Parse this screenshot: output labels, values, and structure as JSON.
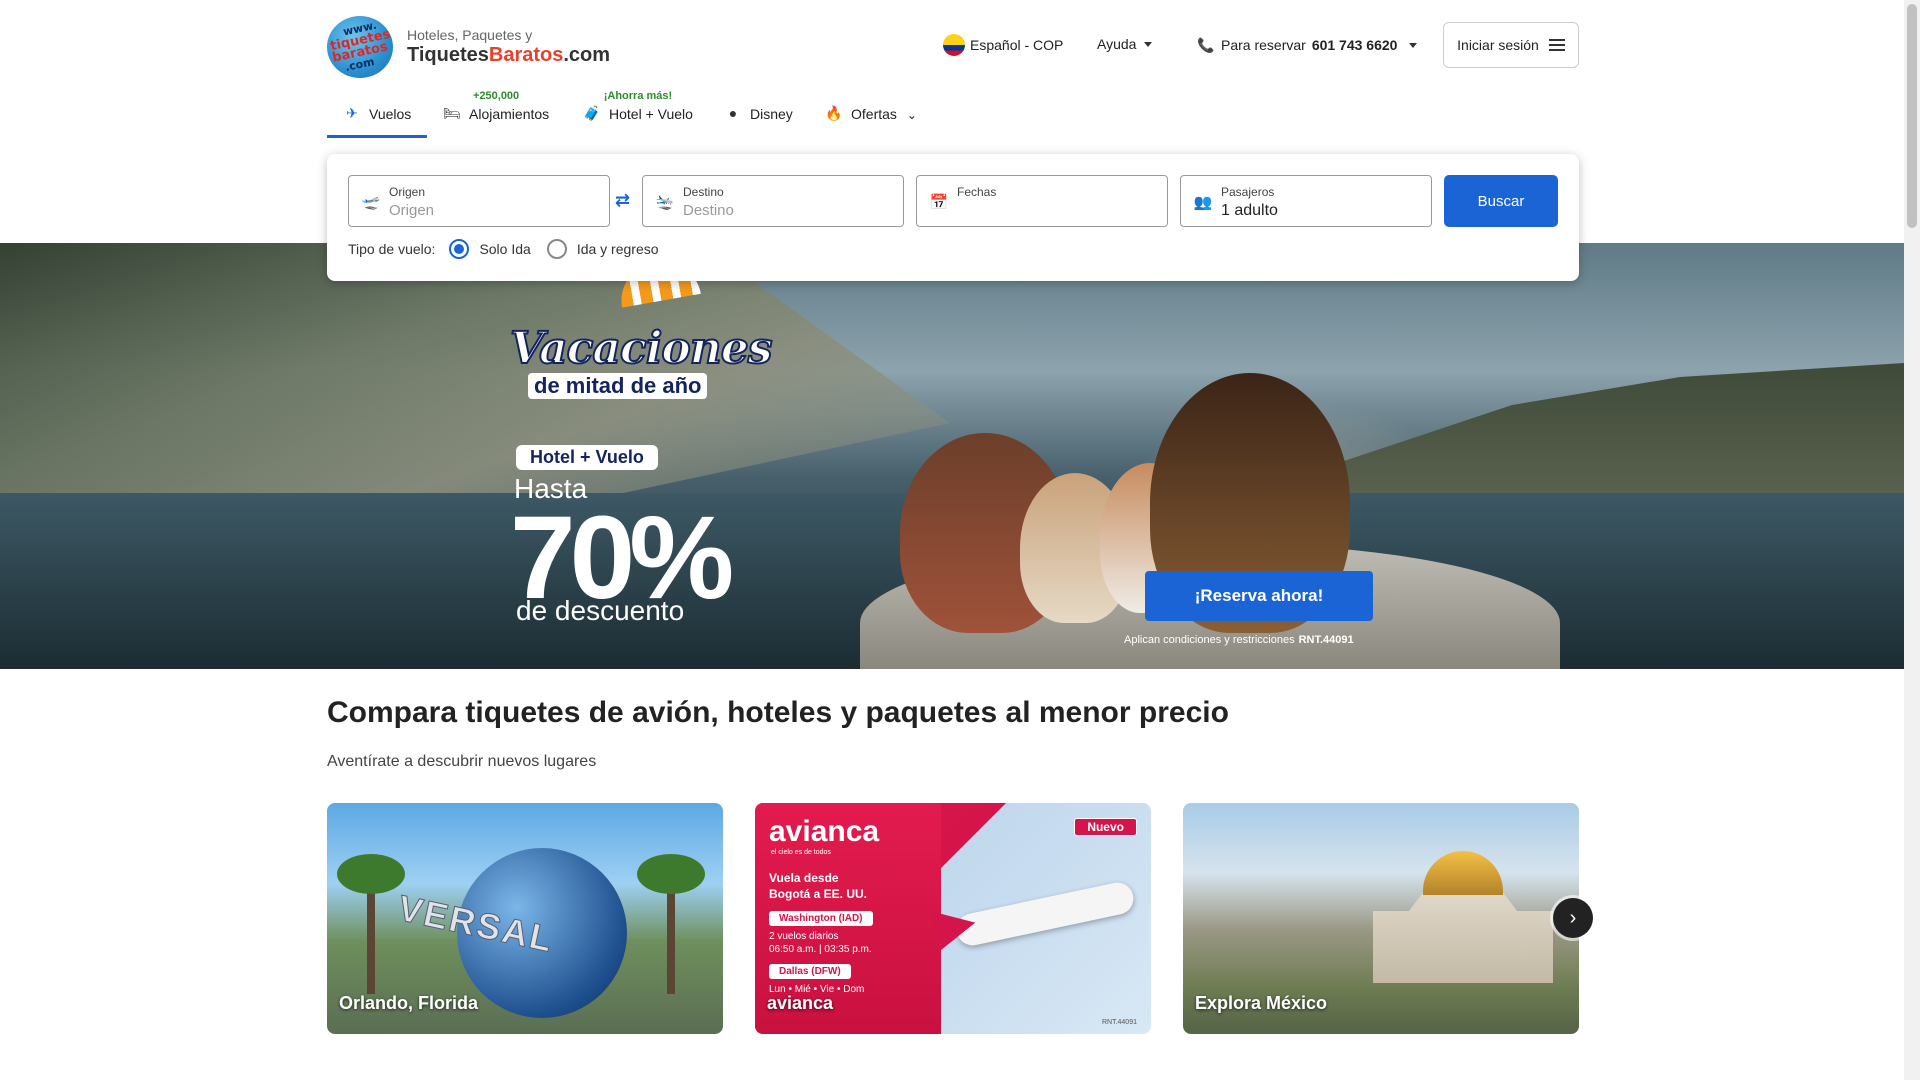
{
  "header": {
    "brand_top": "Hoteles, Paquetes y",
    "brand_main_a": "Tiquetes",
    "brand_main_b": "Baratos",
    "brand_main_c": ".com",
    "logo_line1": "www.",
    "logo_line2": "tiquetes",
    "logo_line3": "baratos",
    "logo_line4": ".com",
    "language": "Español - COP",
    "help": "Ayuda",
    "reserve_label": "Para reservar",
    "phone": "601 743 6620",
    "login": "Iniciar sesión"
  },
  "nav": {
    "tabs": [
      {
        "label": "Vuelos",
        "badge": ""
      },
      {
        "label": "Alojamientos",
        "badge": "+250,000"
      },
      {
        "label": "Hotel + Vuelo",
        "badge": "¡Ahorra más!"
      },
      {
        "label": "Disney",
        "badge": ""
      },
      {
        "label": "Ofertas",
        "badge": ""
      }
    ]
  },
  "search": {
    "origin_label": "Origen",
    "origin_placeholder": "Origen",
    "dest_label": "Destino",
    "dest_placeholder": "Destino",
    "dates_label": "Fechas",
    "pax_label": "Pasajeros",
    "pax_value": "1 adulto",
    "button": "Buscar",
    "trip_type_label": "Tipo de vuelo:",
    "trip_one_way": "Solo Ida",
    "trip_round": "Ida y regreso"
  },
  "hero": {
    "brand_line1": "Vacaciones",
    "brand_line2": "de mitad de año",
    "pill": "Hotel + Vuelo",
    "hasta": "Hasta",
    "percent": "70%",
    "discount": "de descuento",
    "cta": "¡Reserva ahora!",
    "conditions": "Aplican condiciones y restricciones",
    "rnt": "RNT.44091"
  },
  "section": {
    "title": "Compara tiquetes de avión, hoteles y paquetes al menor precio",
    "subtitle": "Aventírate a descubrir nuevos lugares"
  },
  "cards": [
    {
      "caption": "Orlando, Florida",
      "image_text": "VERSAL"
    },
    {
      "caption": "avianca",
      "badge": "Nuevo",
      "logo": "avianca",
      "tagline": "el cielo es de todos",
      "line1": "Vuela desde",
      "line2": "Bogotá a EE. UU.",
      "route1": "Washington (IAD)",
      "info1": "2 vuelos diarios",
      "info2": "06:50 a.m. | 03:35 p.m.",
      "route2": "Dallas (DFW)",
      "info3": "Lun • Mié • Vie • Dom",
      "rnt": "RNT.44091"
    },
    {
      "caption": "Explora México"
    }
  ],
  "colors": {
    "primary": "#1a64d6",
    "brand_red": "#e8412b",
    "badge_green": "#2e8b2e",
    "avianca_red": "#d4144a"
  }
}
